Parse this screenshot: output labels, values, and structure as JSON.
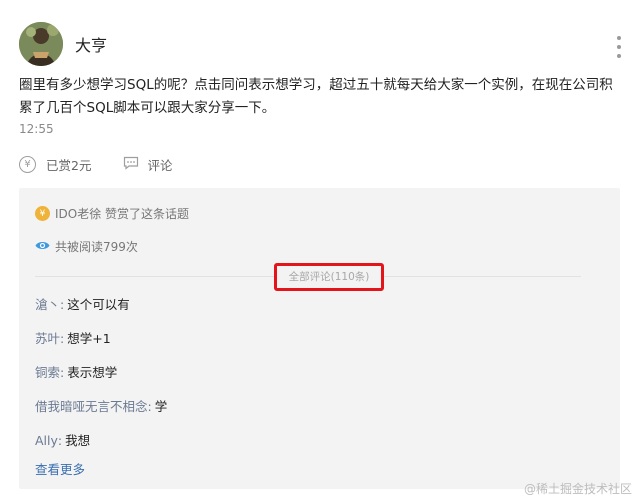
{
  "user": {
    "name": "大亨"
  },
  "post": {
    "content": "圈里有多少想学习SQL的呢？点击同问表示想学习，超过五十就每天给大家一个实例，在现在公司积累了几百个SQL脚本可以跟大家分享一下。",
    "time": "12:55"
  },
  "actions": {
    "reward_icon": "¥",
    "reward_label": "已赏2元",
    "comment_label": "评论"
  },
  "summary": {
    "reward_coin_icon": "¥",
    "reward_text": "IDO老徐 赞赏了这条话题",
    "views_text": "共被阅读799次"
  },
  "comments_header": "全部评论(110条)",
  "comments": [
    {
      "author": "滄丶",
      "sep": ":",
      "text": "这个可以有"
    },
    {
      "author": "苏叶",
      "sep": ":",
      "text": "想学+1"
    },
    {
      "author": "铜索",
      "sep": ":",
      "text": "表示想学"
    },
    {
      "author": "借我暗哑无言不相念",
      "sep": ":",
      "text": "学"
    },
    {
      "author": "Ally",
      "sep": ":",
      "text": "我想"
    }
  ],
  "see_more": "查看更多",
  "watermark": "@稀土掘金技术社区",
  "colors": {
    "link": "#3a6fb0",
    "author": "#6b7a92",
    "highlight": "#e3141a",
    "coin": "#f0b33a"
  },
  "icons": {
    "more": "more-vertical-icon",
    "comment": "comment-icon",
    "eye": "eye-icon",
    "coin": "coin-icon"
  }
}
